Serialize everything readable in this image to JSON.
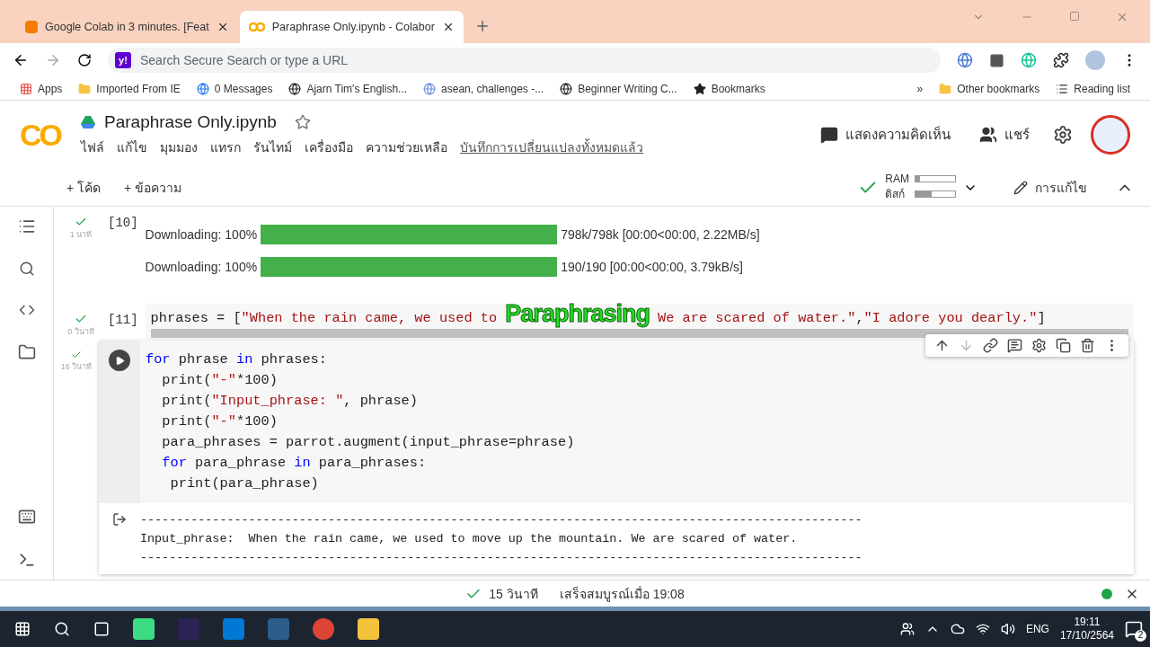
{
  "browser": {
    "tabs": [
      {
        "title": "Google Colab in 3 minutes. [Feat",
        "kind": "blogger",
        "selected": false
      },
      {
        "title": "Paraphrase Only.ipynb - Colabor",
        "kind": "colab",
        "selected": true
      }
    ],
    "address": {
      "icon": "y!",
      "placeholder": "Search Secure Search or type a URL"
    },
    "bookmarks": [
      {
        "label": "Apps",
        "kind": "apps"
      },
      {
        "label": "Imported From IE",
        "kind": "folder"
      },
      {
        "label": "0 Messages",
        "kind": "facebook"
      },
      {
        "label": "Ajarn Tim's English...",
        "kind": "globe"
      },
      {
        "label": "asean, challenges -...",
        "kind": "un"
      },
      {
        "label": "Beginner Writing C...",
        "kind": "globe"
      },
      {
        "label": "Bookmarks",
        "kind": "star"
      }
    ],
    "more": "»",
    "other_bookmarks": "Other bookmarks",
    "reading_list": "Reading list"
  },
  "colab": {
    "logo": "CO",
    "title": "Paraphrase Only.ipynb",
    "menu": [
      "ไฟล์",
      "แก้ไข",
      "มุมมอง",
      "แทรก",
      "รันไทม์",
      "เครื่องมือ",
      "ความช่วยเหลือ"
    ],
    "saved": "บันทึกการเปลี่ยนแปลงทั้งหมดแล้ว",
    "comment": "แสดงความคิดเห็น",
    "share": "แชร์",
    "toolbar": {
      "add_code": "+ โค้ด",
      "add_text": "+ ข้อความ",
      "ram": {
        "label": "RAM",
        "level": 0.12
      },
      "disk": {
        "label": "ดิสก์",
        "level": 0.4
      },
      "edit": "การแก้ไข"
    }
  },
  "cells": [
    {
      "kind": "output",
      "number": "[10]",
      "time": "1 นาที",
      "rows": [
        {
          "label": "Downloading: 100%",
          "level": 1,
          "info": "798k/798k [00:00<00:00, 2.22MB/s]"
        },
        {
          "label": "Downloading: 100%",
          "level": 1,
          "info": "190/190 [00:00<00:00, 3.79kB/s]"
        }
      ]
    },
    {
      "kind": "code",
      "number": "[11]",
      "time": "0 วินาที",
      "lines": [
        [
          {
            "t": "phrases = [",
            "kind": "plain"
          },
          {
            "t": "\"When the rain came, we used to ",
            "kind": "string"
          },
          {
            "t": "Paraphrasing",
            "kind": "overlay"
          },
          {
            "t": " We are scared of water.\"",
            "kind": "string"
          },
          {
            "t": ",",
            "kind": "plain"
          },
          {
            "t": "\"I adore you dearly.\"",
            "kind": "string"
          },
          {
            "t": "]",
            "kind": "plain"
          }
        ]
      ]
    },
    {
      "kind": "active",
      "time": "16 วินาที",
      "lines": [
        [
          {
            "t": "for",
            "kind": "keyword"
          },
          {
            "t": " phrase ",
            "kind": "plain"
          },
          {
            "t": "in",
            "kind": "keyword"
          },
          {
            "t": " phrases:",
            "kind": "plain"
          }
        ],
        [
          {
            "t": "  print(",
            "kind": "plain"
          },
          {
            "t": "\"-\"",
            "kind": "string"
          },
          {
            "t": "*100)",
            "kind": "plain"
          }
        ],
        [
          {
            "t": "  print(",
            "kind": "plain"
          },
          {
            "t": "\"Input_phrase: \"",
            "kind": "string"
          },
          {
            "t": ", phrase)",
            "kind": "plain"
          }
        ],
        [
          {
            "t": "  print(",
            "kind": "plain"
          },
          {
            "t": "\"-\"",
            "kind": "string"
          },
          {
            "t": "*100)",
            "kind": "plain"
          }
        ],
        [
          {
            "t": "  para_phrases = parrot.augment(input_phrase=phrase)",
            "kind": "plain"
          }
        ],
        [
          {
            "t": "  for",
            "kind": "keyword"
          },
          {
            "t": " para_phrase ",
            "kind": "plain"
          },
          {
            "t": "in",
            "kind": "keyword"
          },
          {
            "t": " para_phrases:",
            "kind": "plain"
          }
        ],
        [
          {
            "t": "   print(para_phrase)",
            "kind": "plain"
          }
        ]
      ],
      "output": [
        "----------------------------------------------------------------------------------------------------",
        "Input_phrase:  When the rain came, we used to move up the mountain. We are scared of water.",
        "----------------------------------------------------------------------------------------------------"
      ]
    }
  ],
  "status": {
    "elapsed": "15 วินาที",
    "done": "เสร็จสมบูรณ์เมื่อ 19:08"
  },
  "taskbar": {
    "lang": "ENG",
    "time": "19:11",
    "date": "17/10/2564",
    "notifications": "2"
  }
}
